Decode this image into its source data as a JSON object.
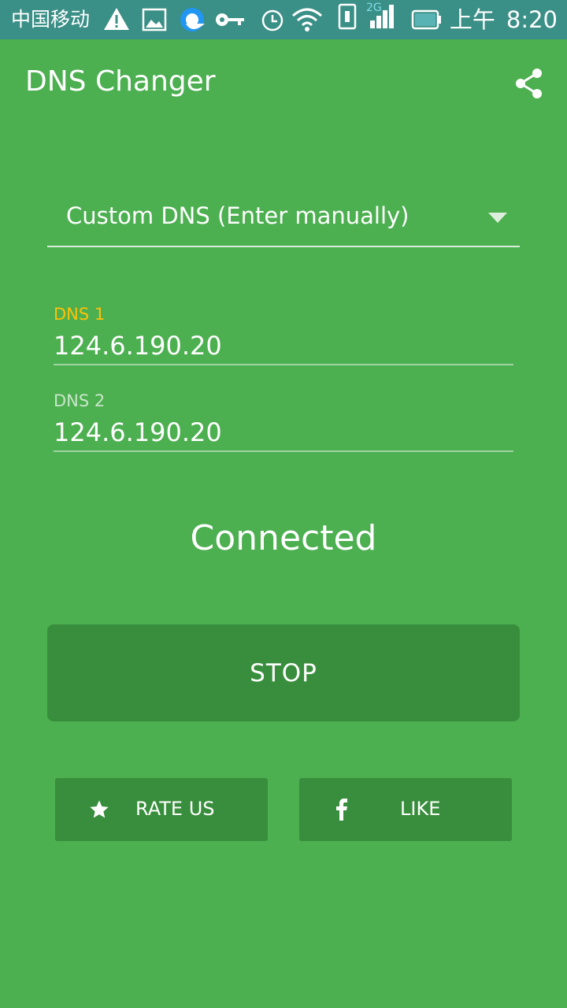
{
  "status_bar": {
    "carrier": "中国移动",
    "network": "2G",
    "time_period": "上午",
    "time": "8:20"
  },
  "toolbar": {
    "title": "DNS Changer",
    "share_icon": "share-icon"
  },
  "dns_selector": {
    "selected": "Custom DNS (Enter manually)"
  },
  "fields": {
    "dns1": {
      "label": "DNS 1",
      "value": "124.6.190.20"
    },
    "dns2": {
      "label": "DNS 2",
      "value": "124.6.190.20"
    }
  },
  "status": {
    "text": "Connected"
  },
  "actions": {
    "stop_label": "STOP",
    "rate_label": "RATE US",
    "rate_icon": "star-icon",
    "like_label": "LIKE",
    "like_icon": "facebook-icon"
  },
  "colors": {
    "background": "#4caf50",
    "status_bar": "#3a8f86",
    "button": "#388e3c",
    "focused_label": "#ffc107"
  }
}
